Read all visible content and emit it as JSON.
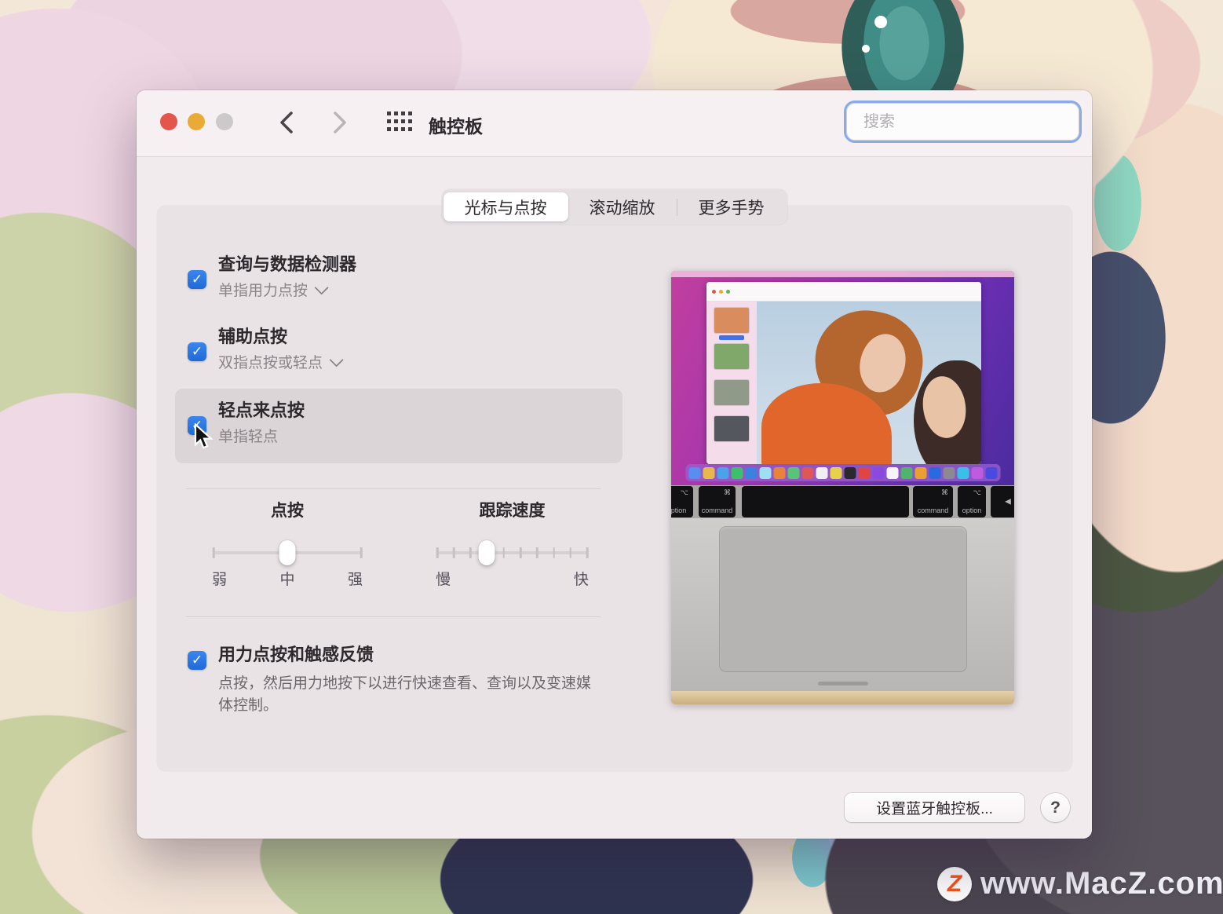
{
  "window": {
    "title": "触控板",
    "search": {
      "placeholder": "搜索"
    }
  },
  "tabs": [
    {
      "label": "光标与点按",
      "selected": true
    },
    {
      "label": "滚动缩放",
      "selected": false
    },
    {
      "label": "更多手势",
      "selected": false
    }
  ],
  "options": [
    {
      "label": "查询与数据检测器",
      "sublabel": "单指用力点按",
      "has_dropdown": true,
      "checked": true
    },
    {
      "label": "辅助点按",
      "sublabel": "双指点按或轻点",
      "has_dropdown": true,
      "checked": true
    },
    {
      "label": "轻点来点按",
      "sublabel": "单指轻点",
      "has_dropdown": false,
      "checked": true,
      "highlighted": true
    }
  ],
  "sliders": {
    "click": {
      "label": "点按",
      "ticks": 3,
      "value_percent": 50,
      "tick_labels": [
        "弱",
        "中",
        "强"
      ]
    },
    "tracking": {
      "label": "跟踪速度",
      "ticks": 10,
      "value_percent": 33,
      "min_label": "慢",
      "max_label": "快"
    }
  },
  "force_click": {
    "label": "用力点按和触感反馈",
    "checked": true,
    "description": "点按，然后用力地按下以进行快速查看、查询以及变速媒体控制。"
  },
  "footer": {
    "bluetooth_button": "设置蓝牙触控板...",
    "help_button": "?"
  },
  "demo": {
    "keys": [
      {
        "symbol": "⌥",
        "label": "option"
      },
      {
        "symbol": "⌘",
        "label": "command"
      },
      {
        "symbol": "",
        "label": ""
      },
      {
        "symbol": "⌘",
        "label": "command"
      },
      {
        "symbol": "⌥",
        "label": "option"
      },
      {
        "symbol": "◀",
        "label": ""
      }
    ],
    "dock_icons": [
      "#5a8df0",
      "#e8b84b",
      "#4aa3e8",
      "#3dc06a",
      "#3b82e0",
      "#9de0f2",
      "#e8833a",
      "#58c474",
      "#e05555",
      "#f0f0f2",
      "#e8d04a",
      "#2a2a2c",
      "#e04545",
      "#8a4ae0",
      "#f5f5f7",
      "#50b46a",
      "#e8a030",
      "#2a6ae0",
      "#8a8a90",
      "#3ac0e8",
      "#c05ae0",
      "#4a4ae0"
    ],
    "sidebar_thumbs": [
      "#d98d5f",
      "#7fa86a",
      "#8f9a88",
      "#54575e"
    ]
  },
  "watermark": {
    "logo_letter": "Z",
    "text": "www.MacZ.com"
  },
  "colors": {
    "accent_blue": "#2378e0",
    "focus_ring": "#89ace9",
    "window_bg": "#f1ebee",
    "panel_bg": "#e9e3e6",
    "highlight_row": "#dbd5d8"
  }
}
